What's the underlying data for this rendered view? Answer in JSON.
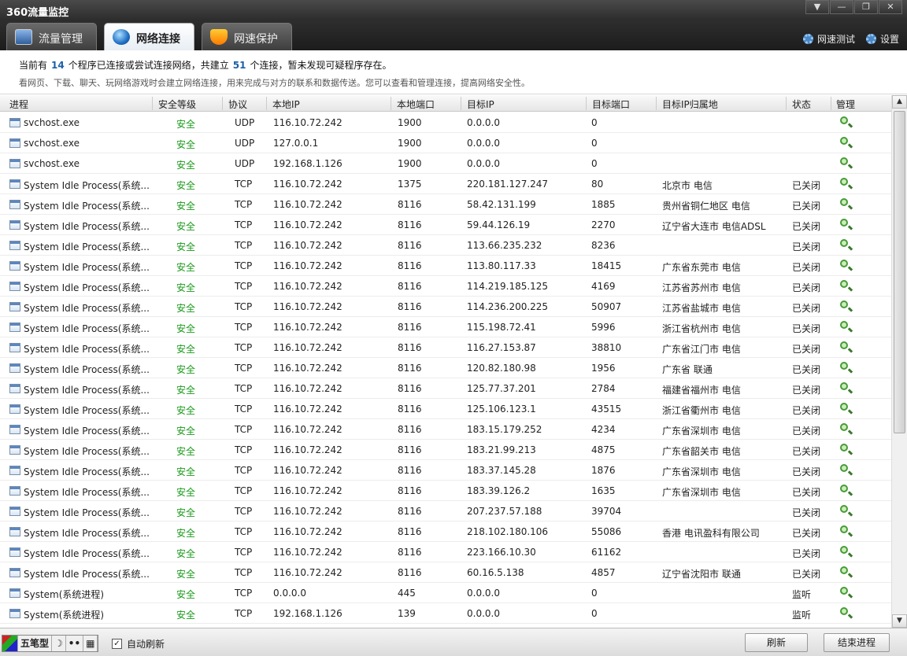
{
  "window": {
    "title": "360流量监控",
    "controls": [
      "▼",
      "—",
      "❐",
      "✕"
    ]
  },
  "tabs": [
    {
      "label": "流量管理",
      "icon": "monitor-icon",
      "active": false
    },
    {
      "label": "网络连接",
      "icon": "globe-icon",
      "active": true
    },
    {
      "label": "网速保护",
      "icon": "shield-icon",
      "active": false
    }
  ],
  "toplinks": {
    "speedtest": "网速测试",
    "settings": "设置"
  },
  "info": {
    "prefix": "当前有",
    "program_count": "14",
    "mid": "个程序已连接或尝试连接网络，共建立",
    "conn_count": "51",
    "suffix": "个连接，暂未发现可疑程序存在。",
    "desc": "看网页、下载、聊天、玩网络游戏时会建立网络连接，用来完成与对方的联系和数据传送。您可以查看和管理连接，提高网络安全性。"
  },
  "columns": {
    "process": "进程",
    "security": "安全等级",
    "protocol": "协议",
    "local_ip": "本地IP",
    "local_port": "本地端口",
    "remote_ip": "目标IP",
    "remote_port": "目标端口",
    "location": "目标IP归属地",
    "state": "状态",
    "manage": "管理"
  },
  "rows": [
    {
      "proc": "svchost.exe",
      "sec": "安全",
      "proto": "UDP",
      "lip": "116.10.72.242",
      "lport": "1900",
      "rip": "0.0.0.0",
      "rport": "0",
      "loc": "",
      "state": ""
    },
    {
      "proc": "svchost.exe",
      "sec": "安全",
      "proto": "UDP",
      "lip": "127.0.0.1",
      "lport": "1900",
      "rip": "0.0.0.0",
      "rport": "0",
      "loc": "",
      "state": ""
    },
    {
      "proc": "svchost.exe",
      "sec": "安全",
      "proto": "UDP",
      "lip": "192.168.1.126",
      "lport": "1900",
      "rip": "0.0.0.0",
      "rport": "0",
      "loc": "",
      "state": ""
    },
    {
      "proc": "System Idle Process(系统...",
      "sec": "安全",
      "proto": "TCP",
      "lip": "116.10.72.242",
      "lport": "1375",
      "rip": "220.181.127.247",
      "rport": "80",
      "loc": "北京市  电信",
      "state": "已关闭"
    },
    {
      "proc": "System Idle Process(系统...",
      "sec": "安全",
      "proto": "TCP",
      "lip": "116.10.72.242",
      "lport": "8116",
      "rip": "58.42.131.199",
      "rport": "1885",
      "loc": "贵州省铜仁地区  电信",
      "state": "已关闭"
    },
    {
      "proc": "System Idle Process(系统...",
      "sec": "安全",
      "proto": "TCP",
      "lip": "116.10.72.242",
      "lport": "8116",
      "rip": "59.44.126.19",
      "rport": "2270",
      "loc": "辽宁省大连市  电信ADSL",
      "state": "已关闭"
    },
    {
      "proc": "System Idle Process(系统...",
      "sec": "安全",
      "proto": "TCP",
      "lip": "116.10.72.242",
      "lport": "8116",
      "rip": "113.66.235.232",
      "rport": "8236",
      "loc": "",
      "state": "已关闭"
    },
    {
      "proc": "System Idle Process(系统...",
      "sec": "安全",
      "proto": "TCP",
      "lip": "116.10.72.242",
      "lport": "8116",
      "rip": "113.80.117.33",
      "rport": "18415",
      "loc": "广东省东莞市  电信",
      "state": "已关闭"
    },
    {
      "proc": "System Idle Process(系统...",
      "sec": "安全",
      "proto": "TCP",
      "lip": "116.10.72.242",
      "lport": "8116",
      "rip": "114.219.185.125",
      "rport": "4169",
      "loc": "江苏省苏州市  电信",
      "state": "已关闭"
    },
    {
      "proc": "System Idle Process(系统...",
      "sec": "安全",
      "proto": "TCP",
      "lip": "116.10.72.242",
      "lport": "8116",
      "rip": "114.236.200.225",
      "rport": "50907",
      "loc": "江苏省盐城市  电信",
      "state": "已关闭"
    },
    {
      "proc": "System Idle Process(系统...",
      "sec": "安全",
      "proto": "TCP",
      "lip": "116.10.72.242",
      "lport": "8116",
      "rip": "115.198.72.41",
      "rport": "5996",
      "loc": "浙江省杭州市  电信",
      "state": "已关闭"
    },
    {
      "proc": "System Idle Process(系统...",
      "sec": "安全",
      "proto": "TCP",
      "lip": "116.10.72.242",
      "lport": "8116",
      "rip": "116.27.153.87",
      "rport": "38810",
      "loc": "广东省江门市  电信",
      "state": "已关闭"
    },
    {
      "proc": "System Idle Process(系统...",
      "sec": "安全",
      "proto": "TCP",
      "lip": "116.10.72.242",
      "lport": "8116",
      "rip": "120.82.180.98",
      "rport": "1956",
      "loc": "广东省  联通",
      "state": "已关闭"
    },
    {
      "proc": "System Idle Process(系统...",
      "sec": "安全",
      "proto": "TCP",
      "lip": "116.10.72.242",
      "lport": "8116",
      "rip": "125.77.37.201",
      "rport": "2784",
      "loc": "福建省福州市  电信",
      "state": "已关闭"
    },
    {
      "proc": "System Idle Process(系统...",
      "sec": "安全",
      "proto": "TCP",
      "lip": "116.10.72.242",
      "lport": "8116",
      "rip": "125.106.123.1",
      "rport": "43515",
      "loc": "浙江省衢州市  电信",
      "state": "已关闭"
    },
    {
      "proc": "System Idle Process(系统...",
      "sec": "安全",
      "proto": "TCP",
      "lip": "116.10.72.242",
      "lport": "8116",
      "rip": "183.15.179.252",
      "rport": "4234",
      "loc": "广东省深圳市  电信",
      "state": "已关闭"
    },
    {
      "proc": "System Idle Process(系统...",
      "sec": "安全",
      "proto": "TCP",
      "lip": "116.10.72.242",
      "lport": "8116",
      "rip": "183.21.99.213",
      "rport": "4875",
      "loc": "广东省韶关市  电信",
      "state": "已关闭"
    },
    {
      "proc": "System Idle Process(系统...",
      "sec": "安全",
      "proto": "TCP",
      "lip": "116.10.72.242",
      "lport": "8116",
      "rip": "183.37.145.28",
      "rport": "1876",
      "loc": "广东省深圳市  电信",
      "state": "已关闭"
    },
    {
      "proc": "System Idle Process(系统...",
      "sec": "安全",
      "proto": "TCP",
      "lip": "116.10.72.242",
      "lport": "8116",
      "rip": "183.39.126.2",
      "rport": "1635",
      "loc": "广东省深圳市  电信",
      "state": "已关闭"
    },
    {
      "proc": "System Idle Process(系统...",
      "sec": "安全",
      "proto": "TCP",
      "lip": "116.10.72.242",
      "lport": "8116",
      "rip": "207.237.57.188",
      "rport": "39704",
      "loc": "",
      "state": "已关闭"
    },
    {
      "proc": "System Idle Process(系统...",
      "sec": "安全",
      "proto": "TCP",
      "lip": "116.10.72.242",
      "lport": "8116",
      "rip": "218.102.180.106",
      "rport": "55086",
      "loc": "香港  电讯盈科有限公司",
      "state": "已关闭"
    },
    {
      "proc": "System Idle Process(系统...",
      "sec": "安全",
      "proto": "TCP",
      "lip": "116.10.72.242",
      "lport": "8116",
      "rip": "223.166.10.30",
      "rport": "61162",
      "loc": "",
      "state": "已关闭"
    },
    {
      "proc": "System Idle Process(系统...",
      "sec": "安全",
      "proto": "TCP",
      "lip": "116.10.72.242",
      "lport": "8116",
      "rip": "60.16.5.138",
      "rport": "4857",
      "loc": "辽宁省沈阳市  联通",
      "state": "已关闭"
    },
    {
      "proc": "System(系统进程)",
      "sec": "安全",
      "proto": "TCP",
      "lip": "0.0.0.0",
      "lport": "445",
      "rip": "0.0.0.0",
      "rport": "0",
      "loc": "",
      "state": "监听"
    },
    {
      "proc": "System(系统进程)",
      "sec": "安全",
      "proto": "TCP",
      "lip": "192.168.1.126",
      "lport": "139",
      "rip": "0.0.0.0",
      "rport": "0",
      "loc": "",
      "state": "监听"
    }
  ],
  "bottom": {
    "ime_mode": "五笔型",
    "auto_refresh": "自动刷新",
    "refresh_button": "刷新",
    "end_button": "结束进程"
  },
  "colors": {
    "safe": "#1a9a1a",
    "count": "#1d5fa8"
  }
}
